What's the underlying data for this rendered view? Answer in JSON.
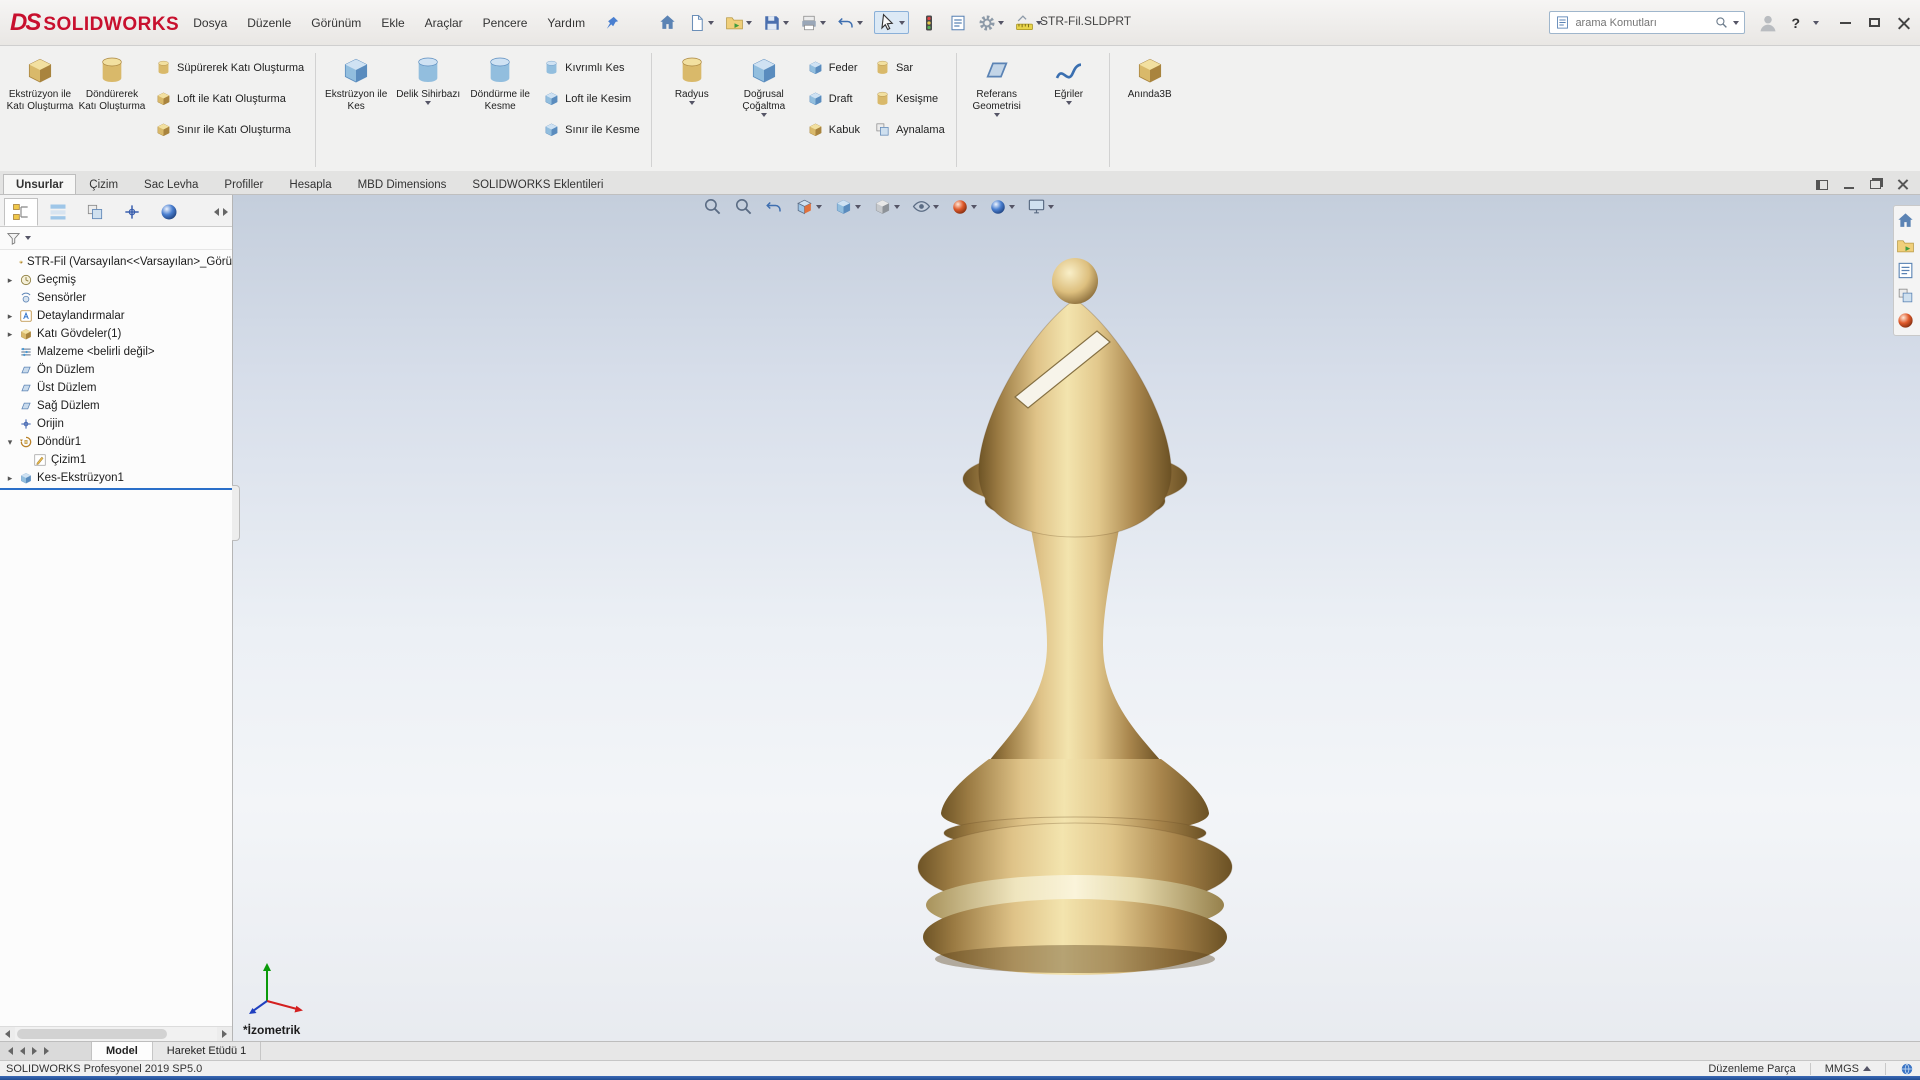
{
  "titlebar": {
    "brand_mark": "DS",
    "brand": "SOLIDWORKS",
    "menus": [
      "Dosya",
      "Düzenle",
      "Görünüm",
      "Ekle",
      "Araçlar",
      "Pencere",
      "Yardım"
    ],
    "document_title": "STR-Fil.SLDPRT",
    "search": {
      "placeholder": "arama Komutları"
    },
    "help_label": "?"
  },
  "ribbon": {
    "extrude_boss": "Ekstrüzyon ile Katı Oluşturma",
    "revolve_boss": "Döndürerek Katı Oluşturma",
    "swept_boss": "Süpürerek Katı Oluşturma",
    "loft_boss": "Loft ile Katı Oluşturma",
    "boundary_boss": "Sınır ile Katı Oluşturma",
    "extrude_cut": "Ekstrüzyon ile Kes",
    "hole_wizard": "Delik Sihirbazı",
    "revolve_cut": "Döndürme ile Kesme",
    "swept_cut": "Kıvrımlı Kes",
    "loft_cut": "Loft ile Kesim",
    "boundary_cut": "Sınır ile Kesme",
    "fillet": "Radyus",
    "linear_pattern": "Doğrusal Çoğaltma",
    "rib": "Feder",
    "draft": "Draft",
    "shell": "Kabuk",
    "wrap": "Sar",
    "intersect": "Kesişme",
    "mirror": "Aynalama",
    "reference_geometry": "Referans Geometrisi",
    "curves": "Eğriler",
    "instant3d": "Anında3B"
  },
  "ribbon_tabs": {
    "items": [
      "Unsurlar",
      "Çizim",
      "Sac Levha",
      "Profiller",
      "Hesapla",
      "MBD Dimensions",
      "SOLIDWORKS Eklentileri"
    ],
    "active": "Unsurlar"
  },
  "tree": {
    "root": "STR-Fil (Varsayılan<<Varsayılan>_Görü",
    "items": [
      {
        "label": "Geçmiş",
        "arrow": "▸"
      },
      {
        "label": "Sensörler",
        "arrow": ""
      },
      {
        "label": "Detaylandırmalar",
        "arrow": "▸"
      },
      {
        "label": "Katı Gövdeler(1)",
        "arrow": "▸"
      },
      {
        "label": "Malzeme <belirli değil>",
        "arrow": ""
      },
      {
        "label": "Ön Düzlem",
        "arrow": ""
      },
      {
        "label": "Üst Düzlem",
        "arrow": ""
      },
      {
        "label": "Sağ Düzlem",
        "arrow": ""
      },
      {
        "label": "Orijin",
        "arrow": ""
      },
      {
        "label": "Döndür1",
        "arrow": "▾"
      },
      {
        "label": "Çizim1",
        "arrow": ""
      },
      {
        "label": "Kes-Ekstrüzyon1",
        "arrow": "▸"
      }
    ]
  },
  "viewport": {
    "view_label": "*İzometrik"
  },
  "bottom_bar": {
    "tabs": [
      "Model",
      "Hareket Etüdü 1"
    ]
  },
  "statusbar": {
    "left": "SOLIDWORKS Profesyonel 2019 SP5.0",
    "mode": "Düzenleme Parça",
    "units": "MMGS"
  }
}
